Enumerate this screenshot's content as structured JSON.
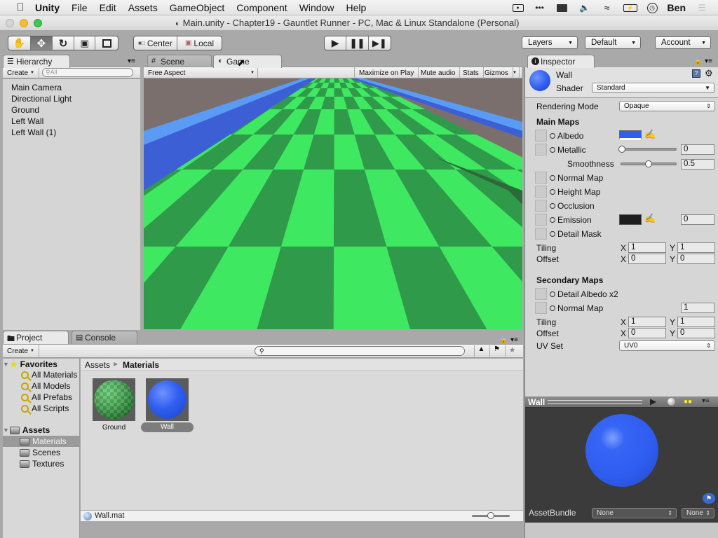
{
  "menubar": {
    "app": "Unity",
    "items": [
      "File",
      "Edit",
      "Assets",
      "GameObject",
      "Component",
      "Window",
      "Help"
    ],
    "user": "Ben",
    "status_icons": [
      "camera-record-icon",
      "more-dots-icon",
      "display-icon",
      "volume-icon",
      "wifi-icon",
      "battery-charging-icon",
      "clock-icon",
      "notification-list-icon"
    ]
  },
  "window": {
    "title": "Main.unity - Chapter19 - Gauntlet Runner - PC, Mac & Linux Standalone (Personal)"
  },
  "toolbar": {
    "tools": [
      "hand-tool",
      "move-tool",
      "rotate-tool",
      "scale-tool",
      "rect-tool"
    ],
    "active_tool": "move-tool",
    "pivot_mode": "Center",
    "pivot_rotation": "Local",
    "layers_label": "Layers",
    "layout_label": "Default",
    "account_label": "Account"
  },
  "hierarchy": {
    "tab_label": "Hierarchy",
    "create_label": "Create",
    "search_placeholder": "All",
    "items": [
      "Main Camera",
      "Directional Light",
      "Ground",
      "Left Wall",
      "Left Wall (1)"
    ]
  },
  "viewport": {
    "tabs": [
      "Scene",
      "Game"
    ],
    "active_tab": "Game",
    "aspect": "Free Aspect",
    "options": [
      "Maximize on Play",
      "Mute audio",
      "Stats",
      "Gizmos"
    ],
    "colors": {
      "sky": "#7a6f6c",
      "wall_top": "#5a9cf5",
      "wall_side": "#3d5fd6",
      "ground_light": "#3ee860",
      "ground_dark": "#2e9a4a"
    }
  },
  "inspector": {
    "tab_label": "Inspector",
    "material_name": "Wall",
    "shader_label": "Shader",
    "shader_value": "Standard",
    "rendering_mode_label": "Rendering Mode",
    "rendering_mode_value": "Opaque",
    "main_maps_label": "Main Maps",
    "albedo_label": "Albedo",
    "albedo_color": "#2f5ef0",
    "metallic_label": "Metallic",
    "metallic_value": "0",
    "smoothness_label": "Smoothness",
    "smoothness_value": "0.5",
    "normal_map_label": "Normal Map",
    "height_map_label": "Height Map",
    "occlusion_label": "Occlusion",
    "emission_label": "Emission",
    "emission_color": "#1e1e1e",
    "emission_value": "0",
    "detail_mask_label": "Detail Mask",
    "tiling_label": "Tiling",
    "offset_label": "Offset",
    "x_label": "X",
    "y_label": "Y",
    "main_tiling_x": "1",
    "main_tiling_y": "1",
    "main_offset_x": "0",
    "main_offset_y": "0",
    "secondary_maps_label": "Secondary Maps",
    "detail_albedo_label": "Detail Albedo x2",
    "secondary_normal_label": "Normal Map",
    "secondary_normal_value": "1",
    "sec_tiling_x": "1",
    "sec_tiling_y": "1",
    "sec_offset_x": "0",
    "sec_offset_y": "0",
    "uv_set_label": "UV Set",
    "uv_set_value": "UV0"
  },
  "preview": {
    "title": "Wall",
    "assetbundle_label": "AssetBundle",
    "assetbundle_value": "None",
    "assetbundle_variant": "None"
  },
  "project": {
    "tabs": [
      "Project",
      "Console"
    ],
    "create_label": "Create",
    "favorites_label": "Favorites",
    "favorites": [
      "All Materials",
      "All Models",
      "All Prefabs",
      "All Scripts"
    ],
    "assets_label": "Assets",
    "folders": [
      "Materials",
      "Scenes",
      "Textures"
    ],
    "selected_folder": "Materials",
    "breadcrumb": [
      "Assets",
      "Materials"
    ],
    "assets": [
      {
        "name": "Ground",
        "type": "checker-material"
      },
      {
        "name": "Wall",
        "type": "blue-material",
        "selected": true
      }
    ],
    "selected_file": "Wall.mat",
    "zoom_slider": 0.5
  }
}
